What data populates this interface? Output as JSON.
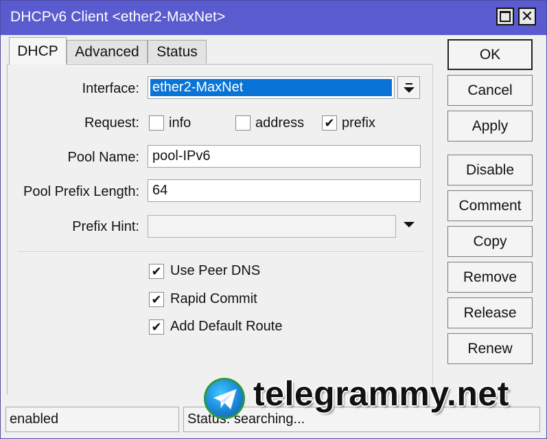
{
  "window": {
    "title": "DHCPv6 Client <ether2-MaxNet>"
  },
  "tabs": [
    {
      "label": "DHCP",
      "active": true
    },
    {
      "label": "Advanced",
      "active": false
    },
    {
      "label": "Status",
      "active": false
    }
  ],
  "form": {
    "interface": {
      "label": "Interface:",
      "value": "ether2-MaxNet"
    },
    "request": {
      "label": "Request:",
      "options": [
        {
          "label": "info",
          "checked": false
        },
        {
          "label": "address",
          "checked": false
        },
        {
          "label": "prefix",
          "checked": true
        }
      ]
    },
    "pool_name": {
      "label": "Pool Name:",
      "value": "pool-IPv6"
    },
    "pool_prefix_length": {
      "label": "Pool Prefix Length:",
      "value": "64"
    },
    "prefix_hint": {
      "label": "Prefix Hint:",
      "value": ""
    },
    "checkboxes": [
      {
        "label": "Use Peer DNS",
        "checked": true
      },
      {
        "label": "Rapid Commit",
        "checked": true
      },
      {
        "label": "Add Default Route",
        "checked": true
      }
    ]
  },
  "buttons": {
    "ok": "OK",
    "cancel": "Cancel",
    "apply": "Apply",
    "disable": "Disable",
    "comment": "Comment",
    "copy": "Copy",
    "remove": "Remove",
    "release": "Release",
    "renew": "Renew"
  },
  "status": {
    "left": "enabled",
    "right": "Status: searching..."
  },
  "watermark": {
    "text": "telegrammy.net",
    "icon": "telegram-logo-icon"
  },
  "colors": {
    "titlebar": "#5b5bd0",
    "selection": "#0a74d6"
  },
  "glyphs": {
    "check": "✔",
    "close": "✕"
  }
}
